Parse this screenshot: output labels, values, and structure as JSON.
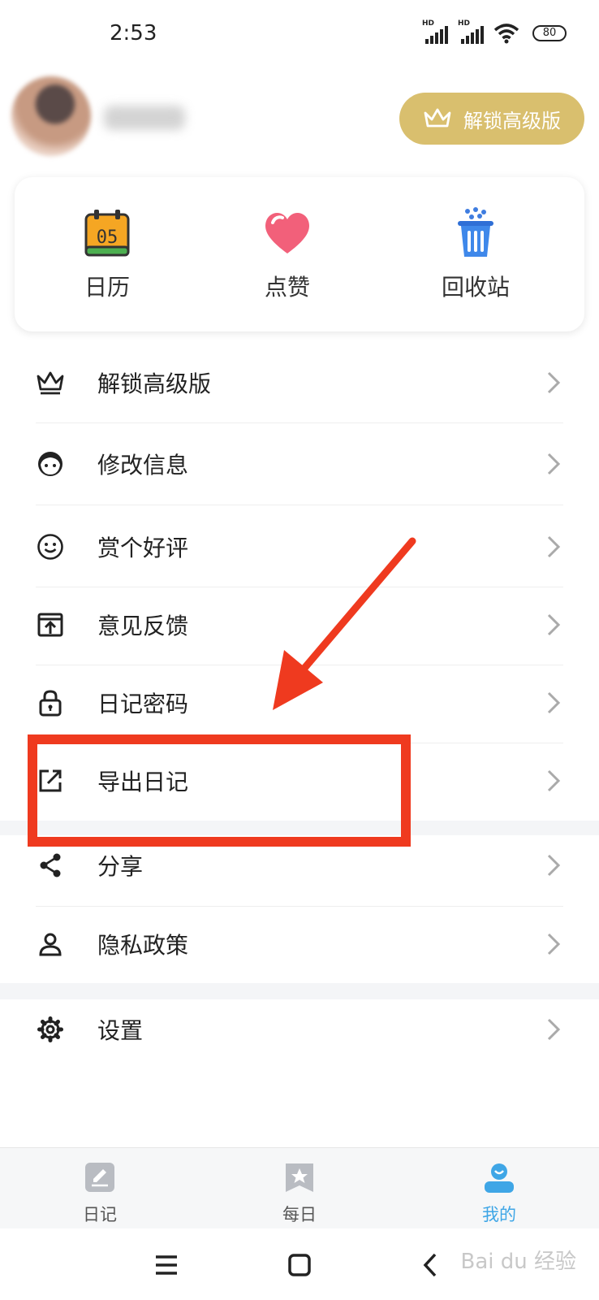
{
  "status_bar": {
    "time": "2:53",
    "signal_1_label": "HD",
    "signal_2_label": "HD",
    "battery": "80"
  },
  "header": {
    "unlock_button_label": "解锁高级版"
  },
  "quick_actions": [
    {
      "label": "日历",
      "icon": "calendar-icon",
      "calendar_day": "05"
    },
    {
      "label": "点赞",
      "icon": "heart-icon"
    },
    {
      "label": "回收站",
      "icon": "trash-icon"
    }
  ],
  "menu": {
    "items": [
      {
        "label": "解锁高级版",
        "icon": "crown-icon"
      },
      {
        "label": "修改信息",
        "icon": "face-icon"
      },
      {
        "label": "赏个好评",
        "icon": "smile-icon"
      },
      {
        "label": "意见反馈",
        "icon": "feedback-icon"
      },
      {
        "label": "日记密码",
        "icon": "lock-icon"
      },
      {
        "label": "导出日记",
        "icon": "export-icon"
      },
      {
        "label": "分享",
        "icon": "share-icon"
      },
      {
        "label": "隐私政策",
        "icon": "person-icon"
      },
      {
        "label": "设置",
        "icon": "gear-icon"
      }
    ]
  },
  "tab_bar": {
    "tabs": [
      {
        "label": "日记",
        "icon": "edit-note-icon",
        "active": false
      },
      {
        "label": "每日",
        "icon": "star-bookmark-icon",
        "active": false
      },
      {
        "label": "我的",
        "icon": "profile-icon",
        "active": true
      }
    ]
  },
  "watermark": "Bai du 经验",
  "colors": {
    "gold": "#d9bf6e",
    "accent_blue": "#3fa6e6",
    "annotation_red": "#ef3a1f"
  }
}
